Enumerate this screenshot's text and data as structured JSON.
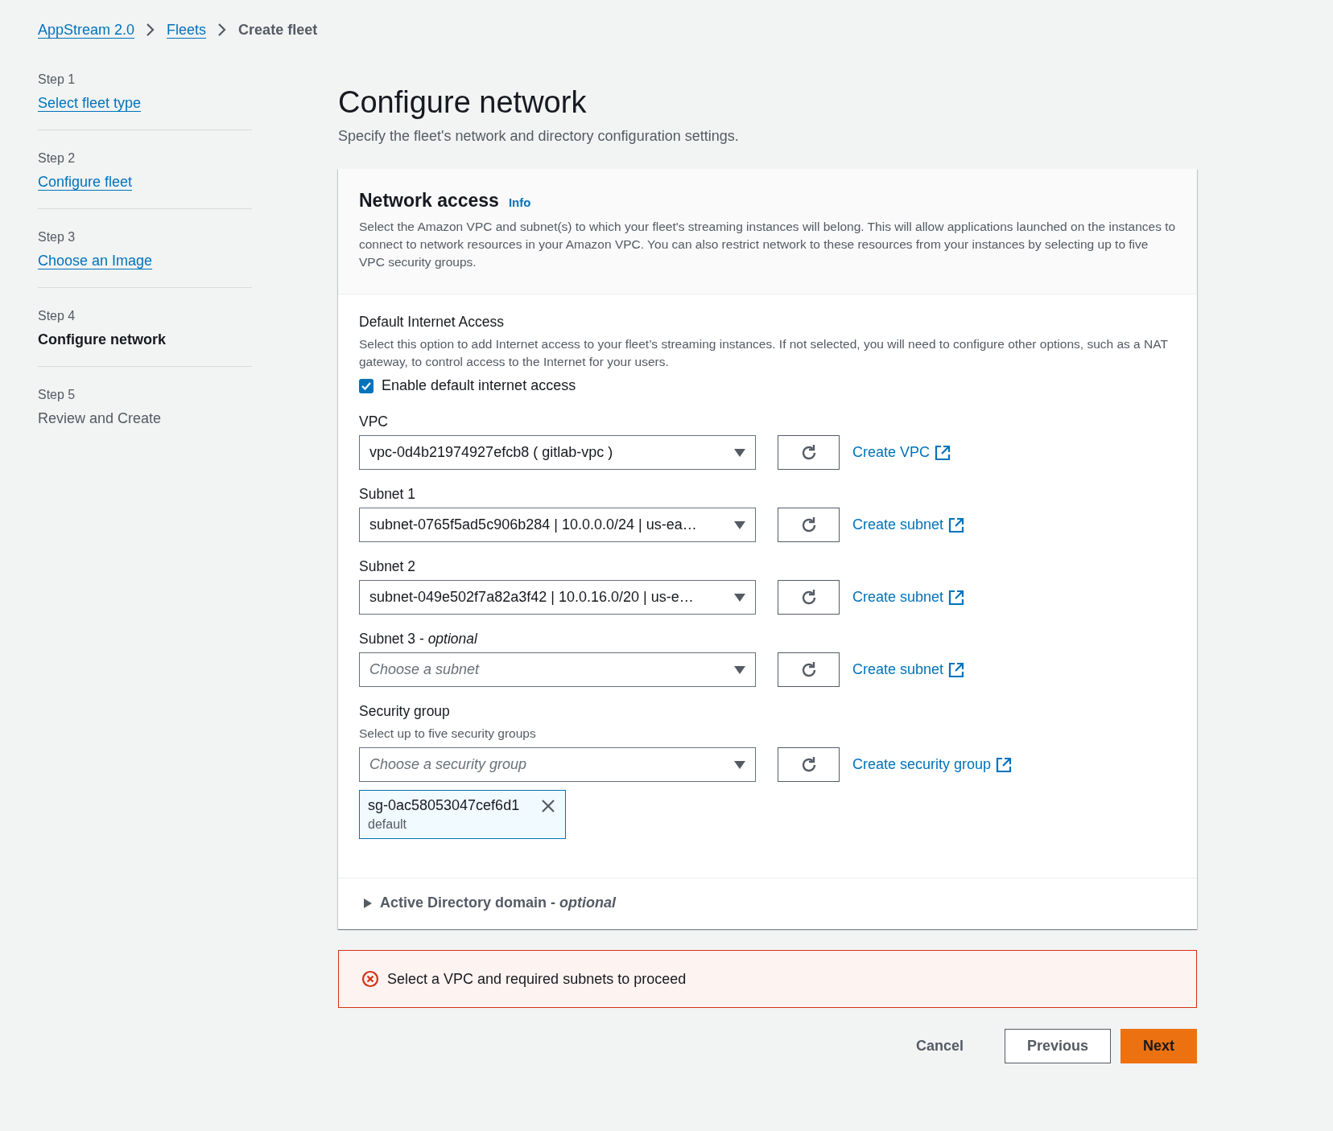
{
  "breadcrumbs": [
    {
      "label": "AppStream 2.0",
      "kind": "link"
    },
    {
      "label": "Fleets",
      "kind": "link"
    },
    {
      "label": "Create fleet",
      "kind": "current"
    }
  ],
  "steps": [
    {
      "step": "Step 1",
      "title": "Select fleet type",
      "kind": "link"
    },
    {
      "step": "Step 2",
      "title": "Configure fleet",
      "kind": "link"
    },
    {
      "step": "Step 3",
      "title": "Choose an Image",
      "kind": "link"
    },
    {
      "step": "Step 4",
      "title": "Configure network",
      "kind": "current"
    },
    {
      "step": "Step 5",
      "title": "Review and Create",
      "kind": "upcoming"
    }
  ],
  "page": {
    "title": "Configure network",
    "description": "Specify the fleet's network and directory configuration settings."
  },
  "network_access": {
    "title": "Network access",
    "info": "Info",
    "description": "Select the Amazon VPC and subnet(s) to which your fleet's streaming instances will belong. This will allow applications launched on the instances to connect to network resources in your Amazon VPC. You can also restrict network to these resources from your instances by selecting up to five VPC security groups."
  },
  "internet_access": {
    "label": "Default Internet Access",
    "description": "Select this option to add Internet access to your fleet’s streaming instances. If not selected, you will need to configure other options, such as a NAT gateway, to control access to the Internet for your users.",
    "checkbox": {
      "label": "Enable default internet access",
      "checked": true
    }
  },
  "fields": [
    {
      "label": "VPC",
      "value": "vpc-0d4b21974927efcb8 ( gitlab-vpc )",
      "create_link": "Create VPC"
    },
    {
      "label": "Subnet 1",
      "value": "subnet-0765f5ad5c906b284 | 10.0.0.0/24 | us-ea…",
      "create_link": "Create subnet"
    },
    {
      "label": "Subnet 2",
      "value": "subnet-049e502f7a82a3f42 | 10.0.16.0/20 | us-e…",
      "create_link": "Create subnet"
    },
    {
      "label": "Subnet 3 - *optional*",
      "placeholder": "Choose a subnet",
      "create_link": "Create subnet"
    },
    {
      "label": "Security group",
      "description": "Select up to five security groups",
      "placeholder": "Choose a security group",
      "create_link": "Create security group",
      "tokens": [
        {
          "value": "sg-0ac58053047cef6d1",
          "description": "default"
        }
      ]
    }
  ],
  "active_directory": {
    "label": "Active Directory domain - *optional*",
    "expanded": false
  },
  "alert": {
    "text": "Select a VPC and required subnets to proceed"
  },
  "buttons": [
    {
      "label": "Cancel",
      "kind": "link"
    },
    {
      "label": "Previous",
      "kind": "normal"
    },
    {
      "label": "Next",
      "kind": "primary"
    }
  ]
}
